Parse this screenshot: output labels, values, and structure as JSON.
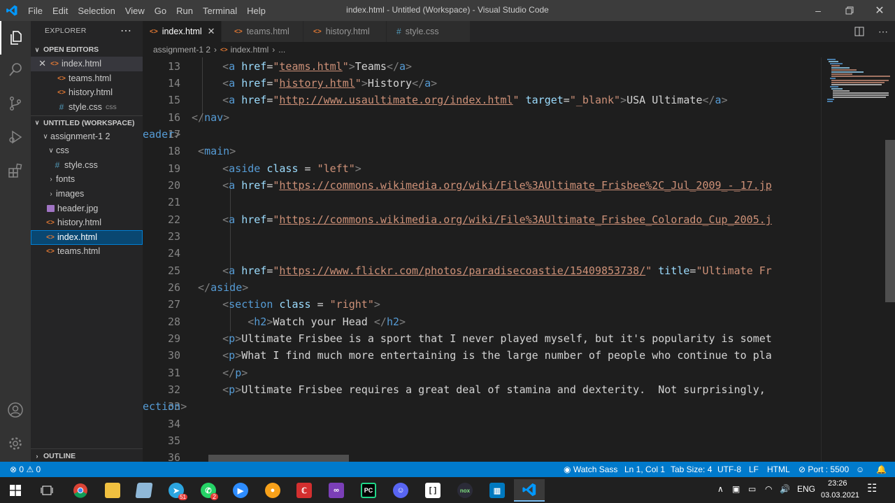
{
  "window": {
    "title": "index.html - Untitled (Workspace) - Visual Studio Code",
    "menu": [
      "File",
      "Edit",
      "Selection",
      "View",
      "Go",
      "Run",
      "Terminal",
      "Help"
    ]
  },
  "sidebar": {
    "header": "EXPLORER",
    "open_editors_title": "OPEN EDITORS",
    "open_editors": [
      {
        "name": "index.html",
        "type": "html",
        "extra": ""
      },
      {
        "name": "teams.html",
        "type": "html",
        "extra": ""
      },
      {
        "name": "history.html",
        "type": "html",
        "extra": ""
      },
      {
        "name": "style.css",
        "type": "css",
        "extra": "css"
      }
    ],
    "workspace_title": "UNTITLED (WORKSPACE)",
    "tree": [
      {
        "name": "assignment-1 2",
        "kind": "folder-open"
      },
      {
        "name": "css",
        "kind": "folder-open"
      },
      {
        "name": "style.css",
        "kind": "css"
      },
      {
        "name": "fonts",
        "kind": "folder"
      },
      {
        "name": "images",
        "kind": "folder"
      },
      {
        "name": "header.jpg",
        "kind": "jpg"
      },
      {
        "name": "history.html",
        "kind": "html"
      },
      {
        "name": "index.html",
        "kind": "html"
      },
      {
        "name": "teams.html",
        "kind": "html"
      }
    ],
    "outline_title": "OUTLINE"
  },
  "tabs": [
    {
      "label": "index.html",
      "type": "html",
      "active": true
    },
    {
      "label": "teams.html",
      "type": "html",
      "active": false
    },
    {
      "label": "history.html",
      "type": "html",
      "active": false
    },
    {
      "label": "style.css",
      "type": "css",
      "active": false
    }
  ],
  "breadcrumb": {
    "folder": "assignment-1 2",
    "file": "index.html",
    "more": "..."
  },
  "editor": {
    "line_numbers": [
      "13",
      "14",
      "15",
      "16",
      "17",
      "18",
      "19",
      "20",
      "21",
      "22",
      "23",
      "24",
      "25",
      "26",
      "27",
      "28",
      "29",
      "30",
      "31",
      "32",
      "33",
      "34",
      "35",
      "36"
    ]
  },
  "statusbar": {
    "problems": "0",
    "warnings": "0",
    "watch_sass": "Watch Sass",
    "position": "Ln 1, Col 1",
    "tab_size": "Tab Size: 4",
    "encoding": "UTF-8",
    "eol": "LF",
    "language": "HTML",
    "port": "Port : 5500"
  },
  "taskbar": {
    "language": "ENG",
    "time": "23:26",
    "date": "03.03.2021",
    "telegram_badge": "51",
    "whatsapp_badge": "2"
  },
  "colors": {
    "accent": "#007acc",
    "tag": "#569cd6",
    "attribute": "#9cdcfe",
    "string": "#ce9178"
  }
}
